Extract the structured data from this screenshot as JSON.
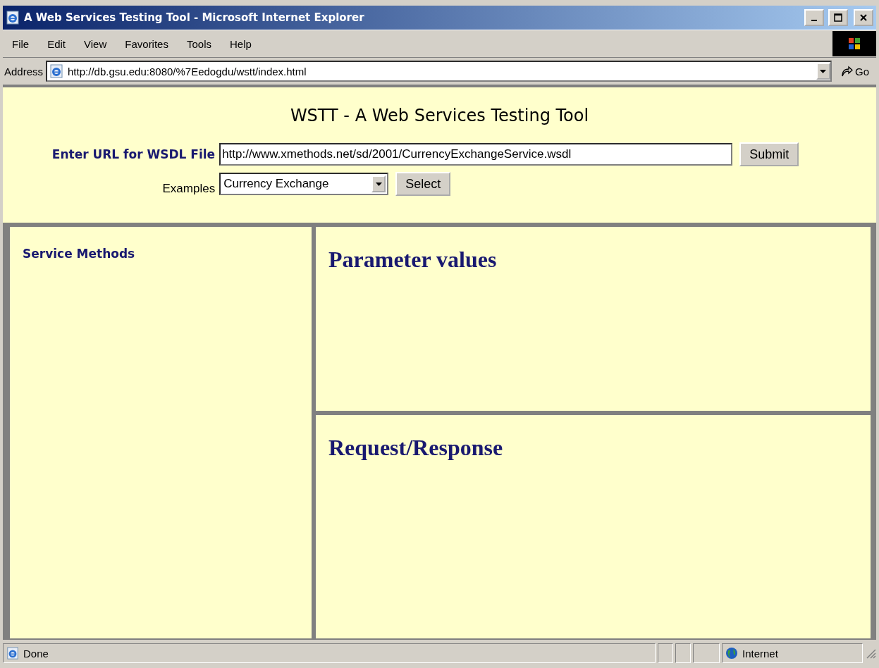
{
  "window": {
    "title": "A Web Services Testing Tool - Microsoft Internet Explorer"
  },
  "menu": [
    "File",
    "Edit",
    "View",
    "Favorites",
    "Tools",
    "Help"
  ],
  "address": {
    "label": "Address",
    "value": "http://db.gsu.edu:8080/%7Eedogdu/wstt/index.html",
    "go": "Go"
  },
  "page": {
    "heading": "WSTT - A Web Services Testing Tool",
    "url_label": "Enter URL for WSDL File",
    "url_value": "http://www.xmethods.net/sd/2001/CurrencyExchangeService.wsdl",
    "submit": "Submit",
    "examples_label": "Examples",
    "examples_value": "Currency Exchange",
    "select": "Select"
  },
  "left_frame": {
    "title": "Service Methods"
  },
  "right_frames": [
    {
      "title": "Parameter values"
    },
    {
      "title": "Request/Response"
    }
  ],
  "status_bar": {
    "text": "Done",
    "zone": "Internet"
  }
}
